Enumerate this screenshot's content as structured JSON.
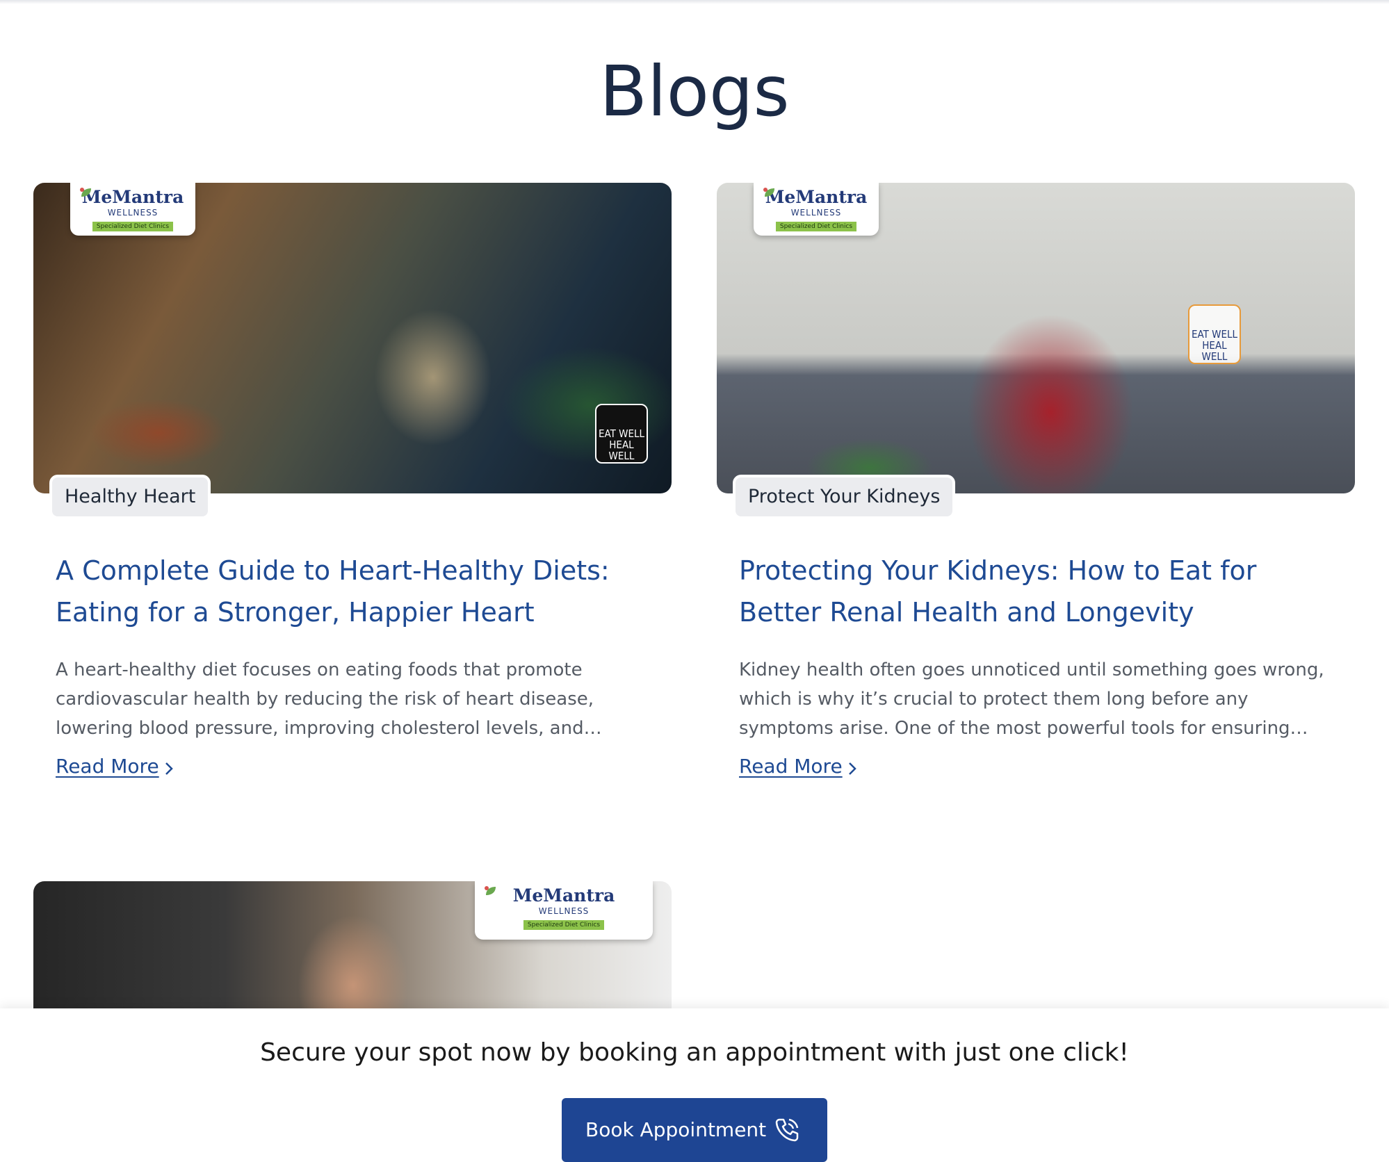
{
  "page": {
    "title": "Blogs"
  },
  "brand": {
    "name": "MeMantra",
    "sub": "WELLNESS",
    "tag": "Specialized Diet Clinics",
    "sticker_line1": "EAT WELL",
    "sticker_line2": "HEAL WELL"
  },
  "posts": [
    {
      "category": "Healthy Heart",
      "title": "A Complete Guide to Heart-Healthy Diets: Eating for a Stronger, Happier Heart",
      "excerpt": "A heart-healthy diet focuses on eating foods that promote cardiovascular health by reducing the risk of heart disease, lowering blood pressure, improving cholesterol levels, and…",
      "read_more": "Read More"
    },
    {
      "category": "Protect Your Kidneys",
      "title": "Protecting Your Kidneys: How to Eat for Better Renal Health and Longevity",
      "excerpt": "Kidney health often goes unnoticed until something goes wrong, which is why it’s crucial to protect them long before any symptoms arise. One of the most powerful tools for ensuring…",
      "read_more": "Read More"
    }
  ],
  "cta": {
    "text": "Secure your spot now by booking an appointment with just one click!",
    "button_label": "Book Appointment"
  },
  "icons": {
    "phone": "phone-call-icon",
    "chevron": "chevron-right-icon",
    "leaf": "leaf-icon"
  },
  "colors": {
    "title": "#1b2a45",
    "link": "#1e4a93",
    "button": "#1e4593",
    "pill": "#ebecef",
    "brand_green": "#8cc24a"
  }
}
